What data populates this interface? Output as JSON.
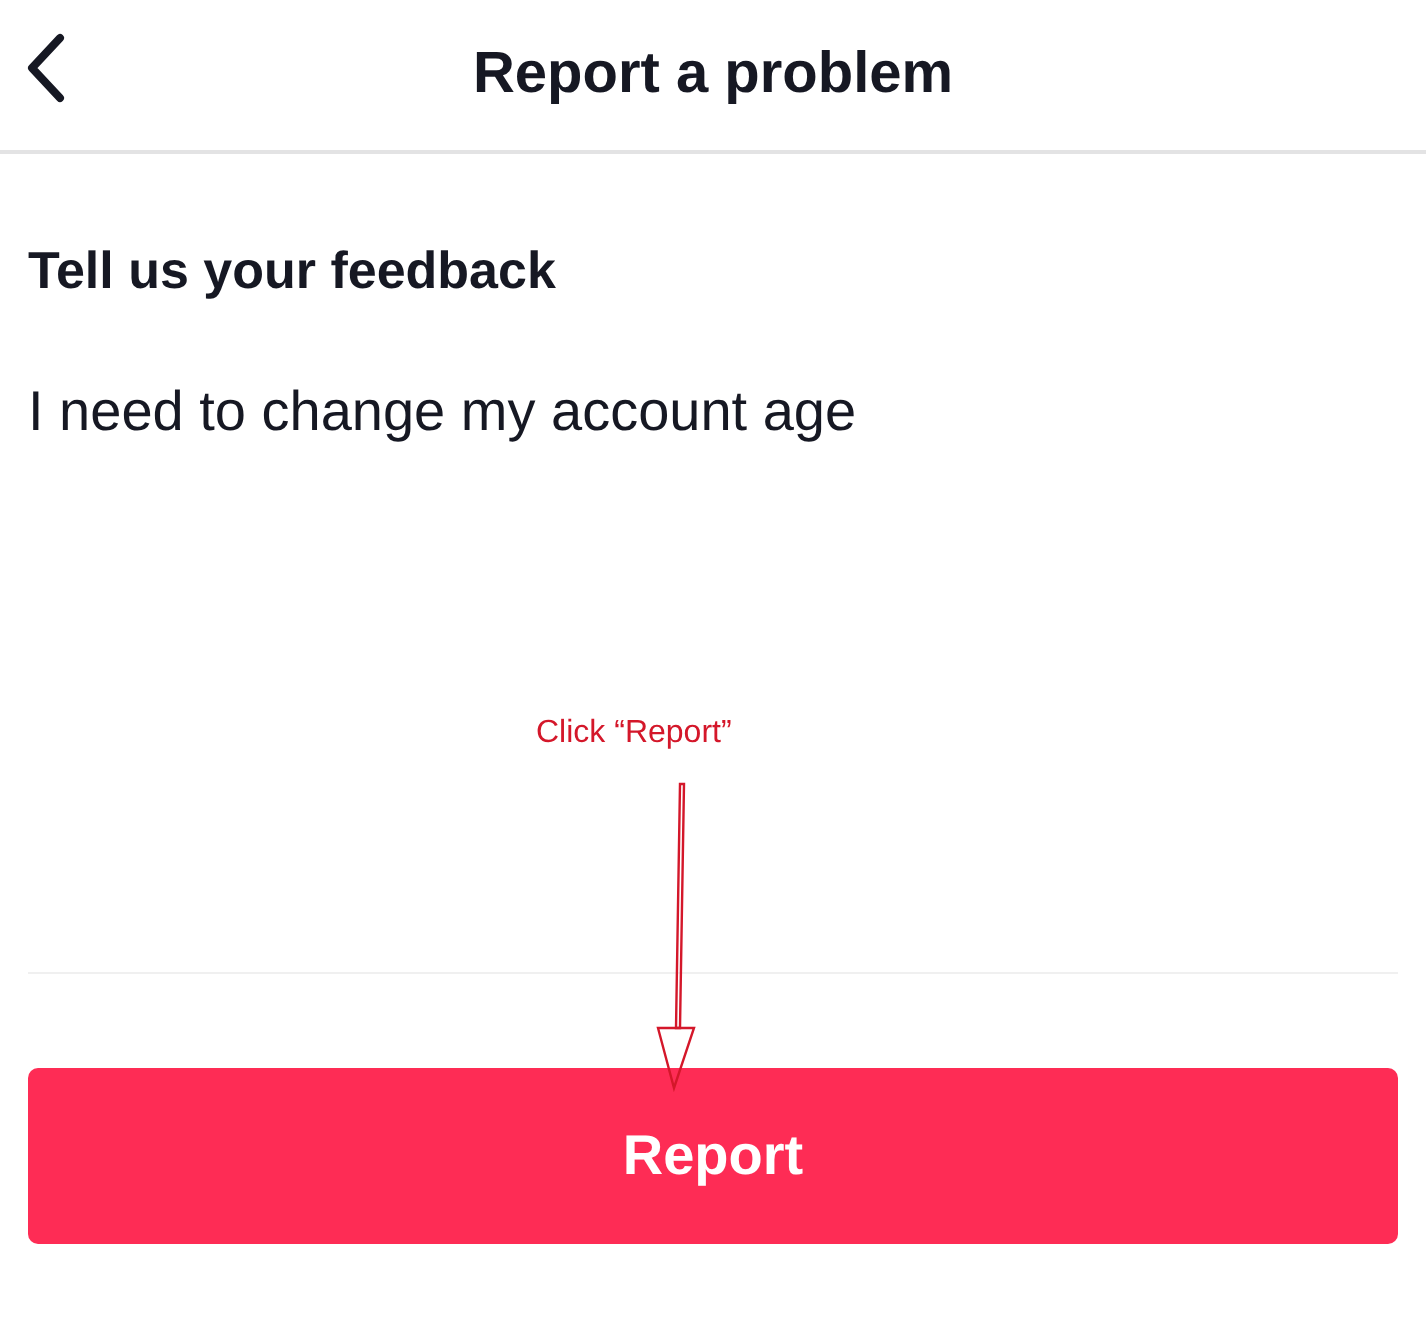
{
  "header": {
    "title": "Report a problem"
  },
  "feedback": {
    "label": "Tell us your feedback",
    "value": "I need to change my account age"
  },
  "annotation": {
    "text": "Click “Report”"
  },
  "buttons": [
    "Report"
  ]
}
